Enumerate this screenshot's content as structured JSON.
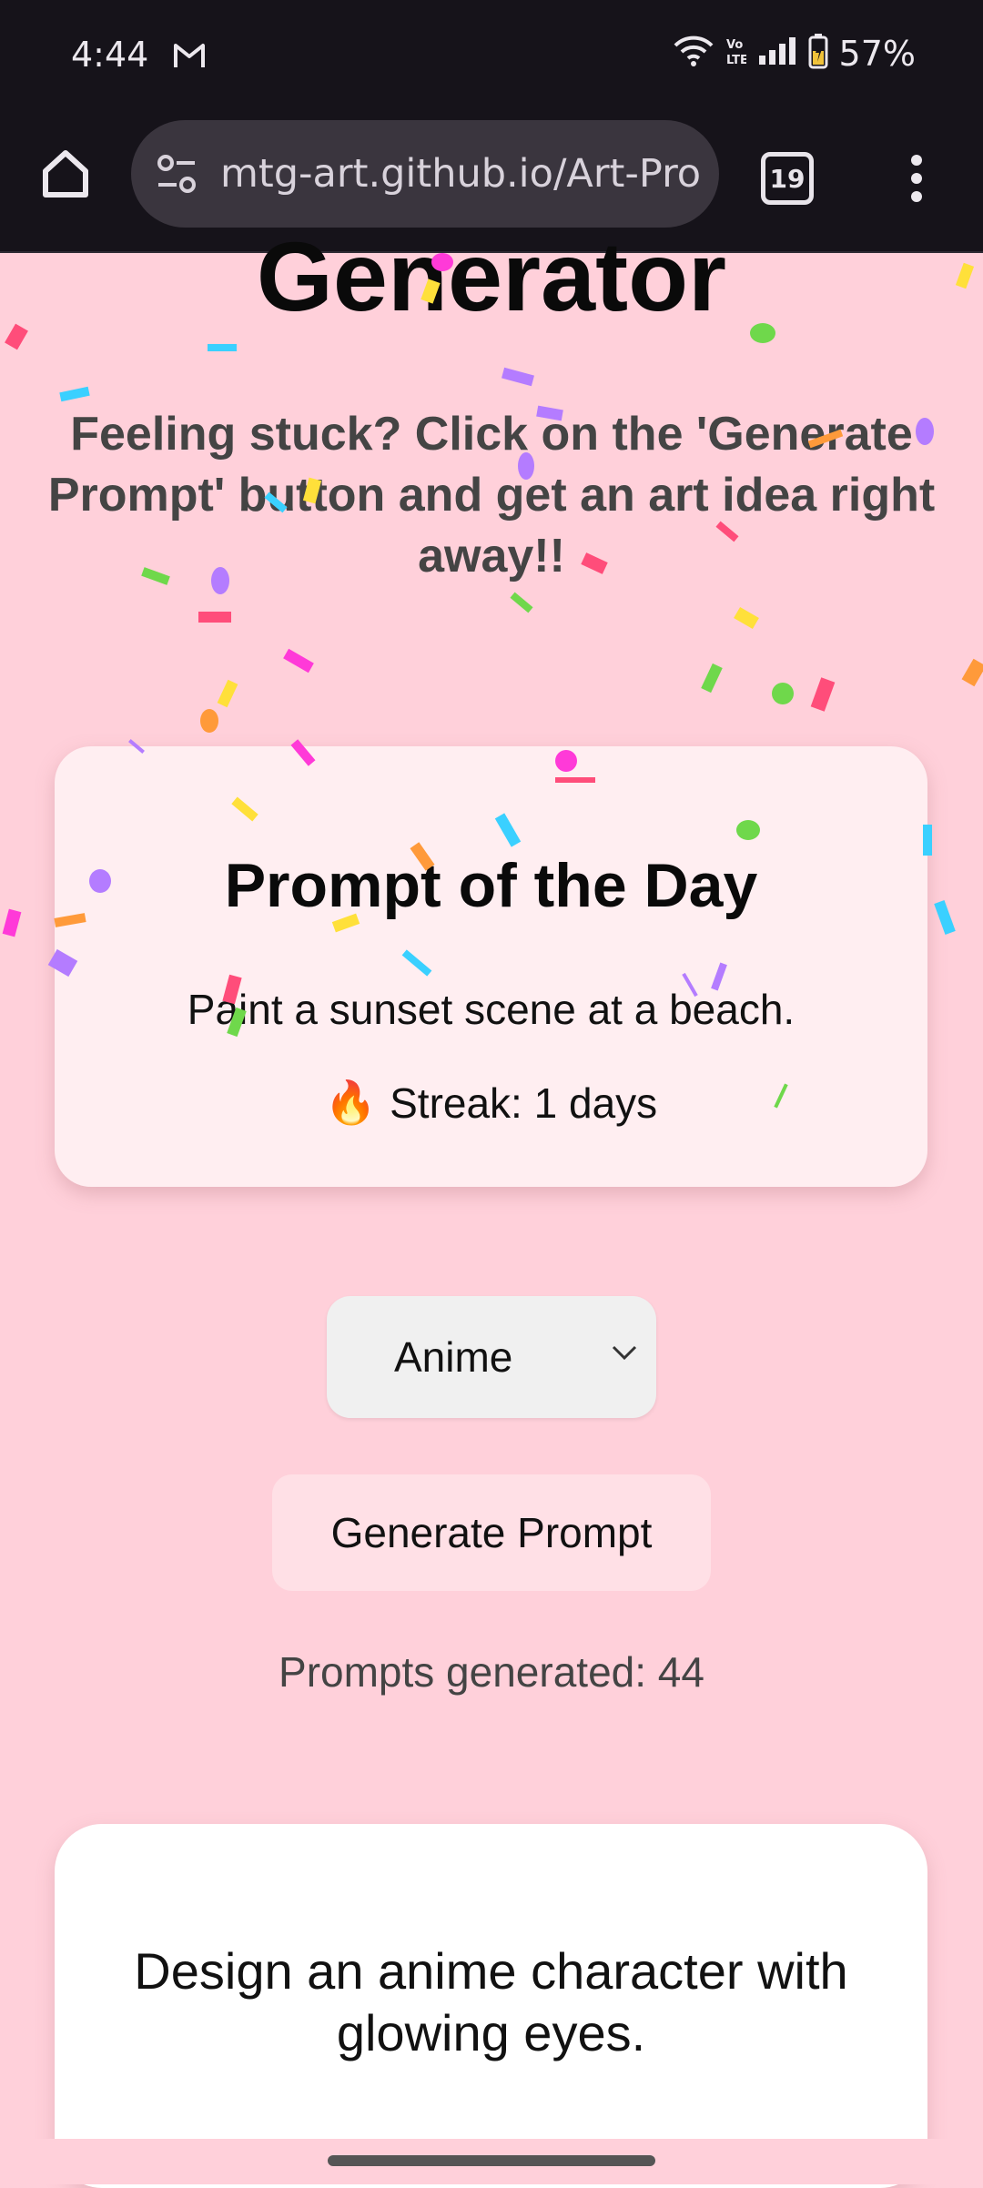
{
  "status_bar": {
    "time": "4:44",
    "battery": "57%"
  },
  "browser": {
    "url": "mtg-art.github.io/Art-Pro",
    "tab_count": "19"
  },
  "page": {
    "title": "Generator",
    "tagline": "Feeling stuck? Click on the 'Generate Prompt' button and get an art idea right away!!",
    "prompt_of_day": {
      "heading": "Prompt of the Day",
      "prompt": "Paint a sunset scene at a beach.",
      "streak_icon": "🔥",
      "streak": "Streak: 1 days"
    },
    "style_select": {
      "selected": "Anime"
    },
    "generate_button": "Generate Prompt",
    "prompts_generated": "Prompts generated: 44",
    "result": "Design an anime character with glowing eyes."
  },
  "colors": {
    "background": "#ffd0da",
    "card": "#ffeef1",
    "button": "#ffe0e6"
  }
}
